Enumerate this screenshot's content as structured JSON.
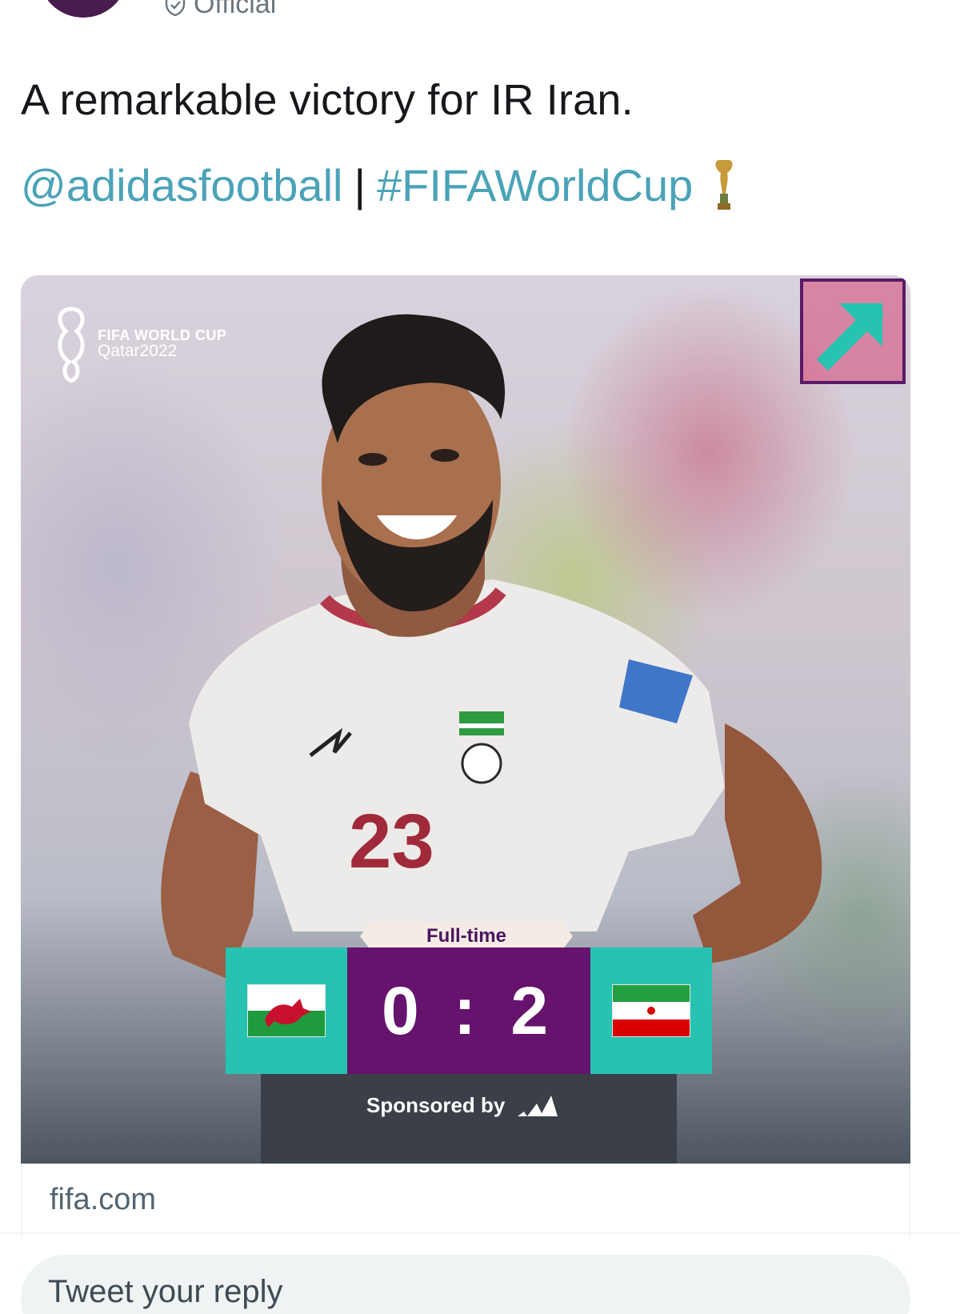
{
  "header": {
    "verified_label": "Official"
  },
  "tweet": {
    "text": "A remarkable victory for IR Iran.",
    "mention": "@adidasfootball",
    "separator": "|",
    "hashtag": "#FIFAWorldCup"
  },
  "media": {
    "logo_line1": "FIFA WORLD CUP",
    "logo_line2": "Qatar2022",
    "jersey_number": "23",
    "status": "Full-time",
    "score": "0 : 2",
    "home_team_flag": "wales-flag-icon",
    "away_team_flag": "iran-flag-icon",
    "sponsored_label": "Sponsored by",
    "sponsor_icon": "adidas-logo-icon"
  },
  "card": {
    "domain": "fifa.com"
  },
  "reply": {
    "placeholder": "Tweet your reply"
  },
  "colors": {
    "link": "#4aa3b8",
    "scorebox": "#66136d",
    "teambox": "#27c3b1",
    "fulltime_bg": "#f4ece4"
  }
}
